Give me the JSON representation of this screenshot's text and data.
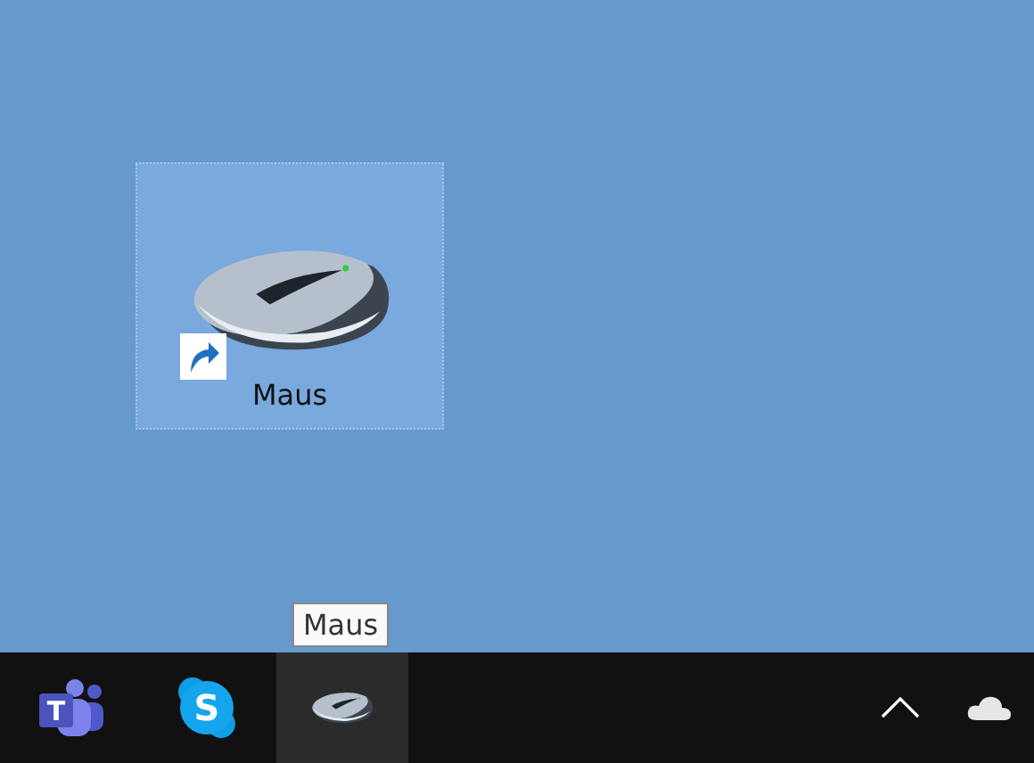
{
  "desktop_icons": [
    {
      "label": "Maus",
      "selected": true,
      "shortcut": true
    }
  ],
  "tooltip": {
    "text": "Maus"
  },
  "taskbar": {
    "apps": [
      {
        "kind": "teams",
        "glyph": "T",
        "selected": false
      },
      {
        "kind": "skype",
        "glyph": "S",
        "selected": false
      },
      {
        "kind": "mouse",
        "selected": true
      }
    ],
    "tray": [
      {
        "kind": "chevron"
      },
      {
        "kind": "cloud"
      }
    ]
  }
}
